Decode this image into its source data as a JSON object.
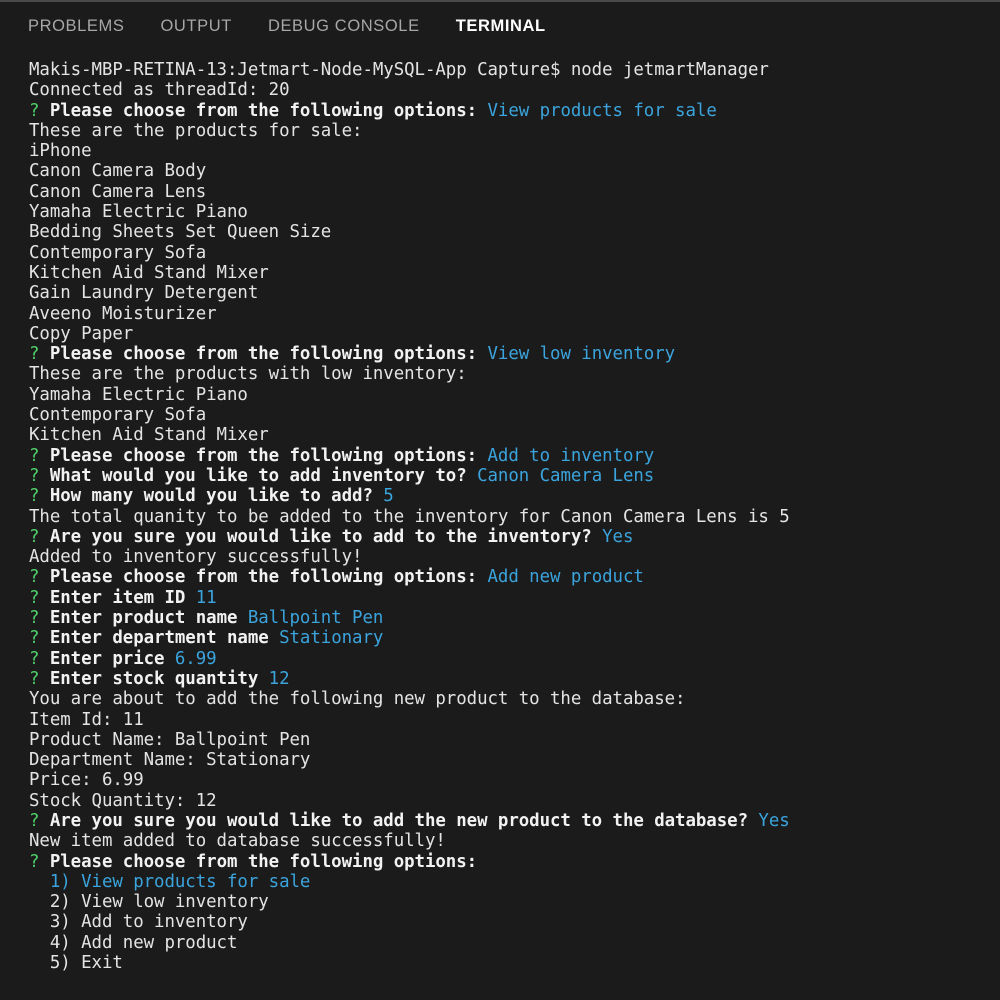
{
  "window": {
    "tabs": [
      {
        "label": "PROBLEMS",
        "active": false
      },
      {
        "label": "OUTPUT",
        "active": false
      },
      {
        "label": "DEBUG CONSOLE",
        "active": false
      },
      {
        "label": "TERMINAL",
        "active": true
      }
    ]
  },
  "colors": {
    "background": "#1b1b1b",
    "foreground": "#e4e4e4",
    "prompt_marker": "#4fd36b",
    "answer": "#3ba4dd",
    "tab_inactive": "#a7a7a7",
    "tab_active": "#ffffff",
    "divider": "#4a4a4a"
  },
  "terminal": {
    "shell_prompt": "Makis-MBP-RETINA-13:Jetmart-Node-MySQL-App Capture$ ",
    "command": "node jetmartManager",
    "connected": "Connected as threadId: 20",
    "marker": "?",
    "lines": [
      {
        "type": "command",
        "prompt": "Makis-MBP-RETINA-13:Jetmart-Node-MySQL-App Capture$ ",
        "command": "node jetmartManager"
      },
      {
        "type": "plain",
        "text": "Connected as threadId: 20"
      },
      {
        "type": "question",
        "marker": "?",
        "prompt": "Please choose from the following options:",
        "answer": "View products for sale"
      },
      {
        "type": "plain",
        "text": "These are the products for sale:"
      },
      {
        "type": "plain",
        "text": "iPhone"
      },
      {
        "type": "plain",
        "text": "Canon Camera Body"
      },
      {
        "type": "plain",
        "text": "Canon Camera Lens"
      },
      {
        "type": "plain",
        "text": "Yamaha Electric Piano"
      },
      {
        "type": "plain",
        "text": "Bedding Sheets Set Queen Size"
      },
      {
        "type": "plain",
        "text": "Contemporary Sofa"
      },
      {
        "type": "plain",
        "text": "Kitchen Aid Stand Mixer"
      },
      {
        "type": "plain",
        "text": "Gain Laundry Detergent"
      },
      {
        "type": "plain",
        "text": "Aveeno Moisturizer"
      },
      {
        "type": "plain",
        "text": "Copy Paper"
      },
      {
        "type": "question",
        "marker": "?",
        "prompt": "Please choose from the following options:",
        "answer": "View low inventory"
      },
      {
        "type": "plain",
        "text": "These are the products with low inventory:"
      },
      {
        "type": "plain",
        "text": "Yamaha Electric Piano"
      },
      {
        "type": "plain",
        "text": "Contemporary Sofa"
      },
      {
        "type": "plain",
        "text": "Kitchen Aid Stand Mixer"
      },
      {
        "type": "question",
        "marker": "?",
        "prompt": "Please choose from the following options:",
        "answer": "Add to inventory"
      },
      {
        "type": "question",
        "marker": "?",
        "prompt": "What would you like to add inventory to?",
        "answer": "Canon Camera Lens"
      },
      {
        "type": "question",
        "marker": "?",
        "prompt": "How many would you like to add?",
        "answer": "5"
      },
      {
        "type": "plain",
        "text": "The total quanity to be added to the inventory for Canon Camera Lens is 5"
      },
      {
        "type": "question",
        "marker": "?",
        "prompt": "Are you sure you would like to add to the inventory?",
        "answer": "Yes"
      },
      {
        "type": "plain",
        "text": "Added to inventory successfully!"
      },
      {
        "type": "question",
        "marker": "?",
        "prompt": "Please choose from the following options:",
        "answer": "Add new product"
      },
      {
        "type": "question",
        "marker": "?",
        "prompt": "Enter item ID",
        "answer": "11"
      },
      {
        "type": "question",
        "marker": "?",
        "prompt": "Enter product name",
        "answer": "Ballpoint Pen"
      },
      {
        "type": "question",
        "marker": "?",
        "prompt": "Enter department name",
        "answer": "Stationary"
      },
      {
        "type": "question",
        "marker": "?",
        "prompt": "Enter price",
        "answer": "6.99"
      },
      {
        "type": "question",
        "marker": "?",
        "prompt": "Enter stock quantity",
        "answer": "12"
      },
      {
        "type": "plain",
        "text": "You are about to add the following new product to the database:"
      },
      {
        "type": "plain",
        "text": "Item Id: 11"
      },
      {
        "type": "plain",
        "text": "Product Name: Ballpoint Pen"
      },
      {
        "type": "plain",
        "text": "Department Name: Stationary"
      },
      {
        "type": "plain",
        "text": "Price: 6.99"
      },
      {
        "type": "plain",
        "text": "Stock Quantity: 12"
      },
      {
        "type": "question",
        "marker": "?",
        "prompt": "Are you sure you would like to add the new product to the database?",
        "answer": "Yes"
      },
      {
        "type": "plain",
        "text": "New item added to database successfully!"
      },
      {
        "type": "question",
        "marker": "?",
        "prompt": "Please choose from the following options:",
        "answer": ""
      },
      {
        "type": "option",
        "text": "  1) View products for sale",
        "selected": true
      },
      {
        "type": "option",
        "text": "  2) View low inventory",
        "selected": false
      },
      {
        "type": "option",
        "text": "  3) Add to inventory",
        "selected": false
      },
      {
        "type": "option",
        "text": "  4) Add new product",
        "selected": false
      },
      {
        "type": "option",
        "text": "  5) Exit",
        "selected": false
      }
    ],
    "menu_options": [
      "1) View products for sale",
      "2) View low inventory",
      "3) Add to inventory",
      "4) Add new product",
      "5) Exit"
    ]
  }
}
